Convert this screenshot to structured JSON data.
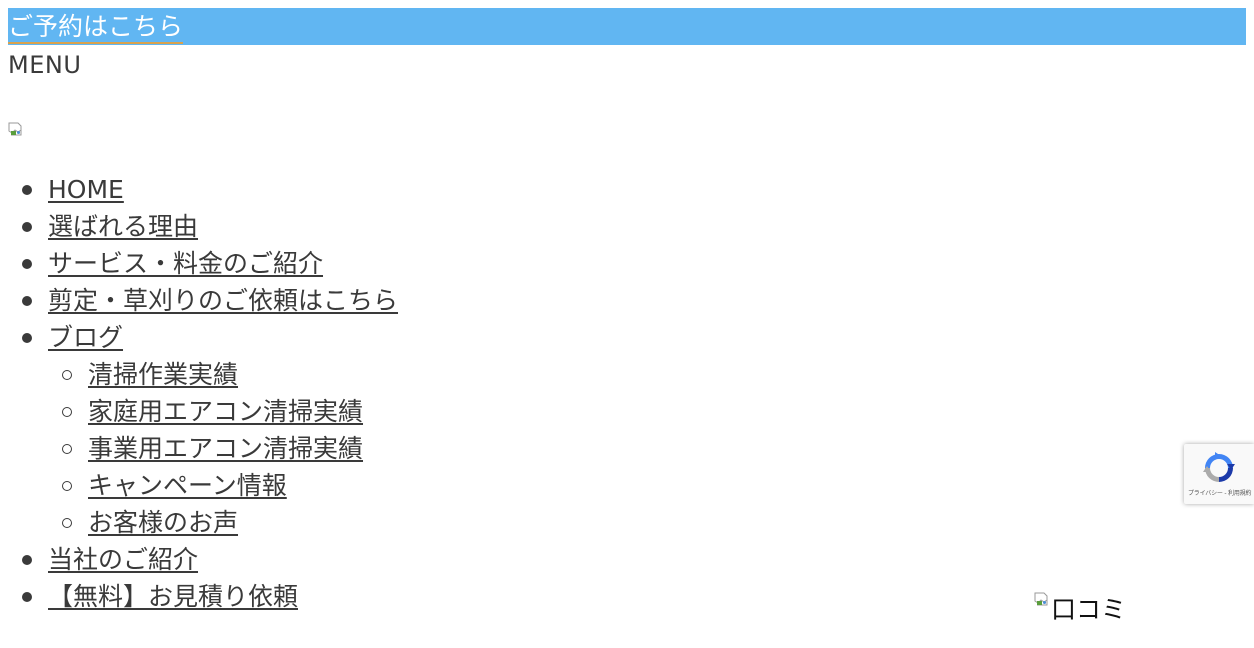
{
  "header": {
    "reserve_label": "ご予約はこちら",
    "menu_label": "MENU",
    "logo_icon": "broken-image-icon"
  },
  "nav": {
    "items": [
      {
        "label": "HOME",
        "level": 1
      },
      {
        "label": "選ばれる理由",
        "level": 1
      },
      {
        "label": "サービス・料金のご紹介",
        "level": 1
      },
      {
        "label": "剪定・草刈りのご依頼はこちら",
        "level": 1
      },
      {
        "label": "ブログ",
        "level": 1
      },
      {
        "label": "清掃作業実績",
        "level": 2
      },
      {
        "label": "家庭用エアコン清掃実績",
        "level": 2
      },
      {
        "label": "事業用エアコン清掃実績",
        "level": 2
      },
      {
        "label": "キャンペーン情報",
        "level": 2
      },
      {
        "label": "お客様のお声",
        "level": 2
      },
      {
        "label": "当社のご紹介",
        "level": 1
      },
      {
        "label": "【無料】お見積り依頼",
        "level": 1
      }
    ]
  },
  "recaptcha": {
    "footer_text": "プライバシー - 利用規約"
  },
  "review": {
    "alt_text": "口コミ",
    "icon": "broken-image-icon"
  },
  "colors": {
    "reserve_bar": "#61b6f2",
    "reserve_underline": "#d9a24e",
    "text": "#3a3a3a"
  }
}
